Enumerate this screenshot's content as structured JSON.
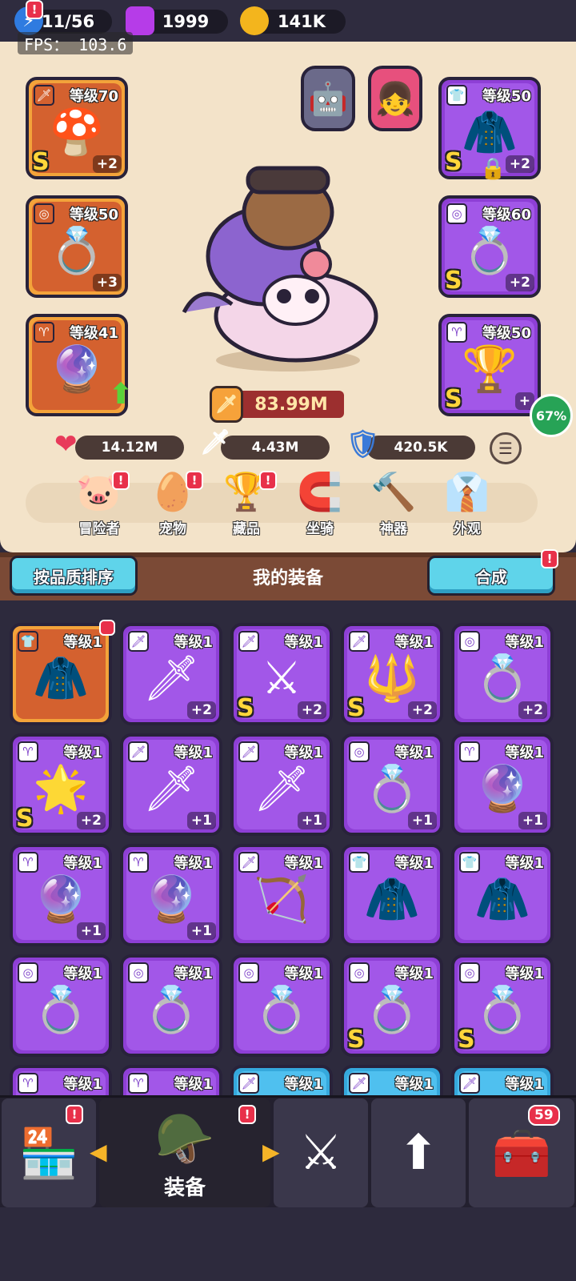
{
  "top": {
    "energy": "11/56",
    "gems": "1999",
    "gold": "141K",
    "fps": "FPS： 103.6",
    "alert": "!"
  },
  "equipped": {
    "left": [
      {
        "level": "等级70",
        "plus": "+2",
        "rank": "S",
        "icon": "🍄",
        "tag": "🗡"
      },
      {
        "level": "等级50",
        "plus": "+3",
        "rank": "",
        "icon": "💍",
        "tag": "◎"
      },
      {
        "level": "等级41",
        "plus": "",
        "rank": "",
        "icon": "🔮",
        "tag": "♈"
      }
    ],
    "right": [
      {
        "level": "等级50",
        "plus": "+2",
        "rank": "S",
        "icon": "🧥",
        "tag": "👕"
      },
      {
        "level": "等级60",
        "plus": "+2",
        "rank": "S",
        "icon": "💍",
        "tag": "◎"
      },
      {
        "level": "等级50",
        "plus": "+",
        "rank": "S",
        "icon": "🏆",
        "tag": "♈"
      }
    ]
  },
  "power": "83.99M",
  "progress_pct": "67%",
  "stats": {
    "hp": "14.12M",
    "atk": "4.43M",
    "def": "420.5K"
  },
  "nav": [
    {
      "label": "冒险者",
      "icon": "🐷",
      "alert": "!"
    },
    {
      "label": "宠物",
      "icon": "🥚",
      "alert": "!"
    },
    {
      "label": "藏品",
      "icon": "🏆",
      "alert": "!"
    },
    {
      "label": "坐骑",
      "icon": "🧲",
      "alert": ""
    },
    {
      "label": "神器",
      "icon": "🔨",
      "alert": ""
    },
    {
      "label": "外观",
      "icon": "👔",
      "alert": ""
    }
  ],
  "inventory_bar": {
    "sort_label": "按品质排序",
    "title": "我的装备",
    "merge_label": "合成",
    "merge_alert": "!"
  },
  "inventory": [
    {
      "q": "orange",
      "level": "等级1",
      "plus": "",
      "rank": "",
      "icon": "🧥",
      "tag": "👕"
    },
    {
      "q": "purple",
      "level": "等级1",
      "plus": "+2",
      "rank": "",
      "icon": "🗡",
      "tag": "🗡"
    },
    {
      "q": "purple",
      "level": "等级1",
      "plus": "+2",
      "rank": "S",
      "icon": "⚔",
      "tag": "🗡"
    },
    {
      "q": "purple",
      "level": "等级1",
      "plus": "+2",
      "rank": "S",
      "icon": "🔱",
      "tag": "🗡"
    },
    {
      "q": "purple",
      "level": "等级1",
      "plus": "+2",
      "rank": "",
      "icon": "💍",
      "tag": "◎"
    },
    {
      "q": "purple",
      "level": "等级1",
      "plus": "+2",
      "rank": "S",
      "icon": "🌟",
      "tag": "♈"
    },
    {
      "q": "purple",
      "level": "等级1",
      "plus": "+1",
      "rank": "",
      "icon": "🗡",
      "tag": "🗡"
    },
    {
      "q": "purple",
      "level": "等级1",
      "plus": "+1",
      "rank": "",
      "icon": "🗡",
      "tag": "🗡"
    },
    {
      "q": "purple",
      "level": "等级1",
      "plus": "+1",
      "rank": "",
      "icon": "💍",
      "tag": "◎"
    },
    {
      "q": "purple",
      "level": "等级1",
      "plus": "+1",
      "rank": "",
      "icon": "🔮",
      "tag": "♈"
    },
    {
      "q": "purple",
      "level": "等级1",
      "plus": "+1",
      "rank": "",
      "icon": "🔮",
      "tag": "♈"
    },
    {
      "q": "purple",
      "level": "等级1",
      "plus": "+1",
      "rank": "",
      "icon": "🔮",
      "tag": "♈"
    },
    {
      "q": "purple",
      "level": "等级1",
      "plus": "",
      "rank": "",
      "icon": "🏹",
      "tag": "🗡"
    },
    {
      "q": "purple",
      "level": "等级1",
      "plus": "",
      "rank": "",
      "icon": "🧥",
      "tag": "👕"
    },
    {
      "q": "purple",
      "level": "等级1",
      "plus": "",
      "rank": "",
      "icon": "🧥",
      "tag": "👕"
    },
    {
      "q": "purple",
      "level": "等级1",
      "plus": "",
      "rank": "",
      "icon": "💍",
      "tag": "◎"
    },
    {
      "q": "purple",
      "level": "等级1",
      "plus": "",
      "rank": "",
      "icon": "💍",
      "tag": "◎"
    },
    {
      "q": "purple",
      "level": "等级1",
      "plus": "",
      "rank": "",
      "icon": "💍",
      "tag": "◎"
    },
    {
      "q": "purple",
      "level": "等级1",
      "plus": "",
      "rank": "S",
      "icon": "💍",
      "tag": "◎"
    },
    {
      "q": "purple",
      "level": "等级1",
      "plus": "",
      "rank": "S",
      "icon": "💍",
      "tag": "◎"
    },
    {
      "q": "purple",
      "level": "等级1",
      "plus": "",
      "rank": "",
      "icon": "",
      "tag": "♈"
    },
    {
      "q": "purple",
      "level": "等级1",
      "plus": "",
      "rank": "",
      "icon": "",
      "tag": "♈"
    },
    {
      "q": "blue",
      "level": "等级1",
      "plus": "",
      "rank": "",
      "icon": "",
      "tag": "🗡"
    },
    {
      "q": "blue",
      "level": "等级1",
      "plus": "",
      "rank": "",
      "icon": "",
      "tag": "🗡"
    },
    {
      "q": "blue",
      "level": "等级1",
      "plus": "",
      "rank": "",
      "icon": "",
      "tag": "🗡"
    }
  ],
  "bottom_tabs": [
    {
      "name": "shop",
      "icon": "🏪",
      "label": "",
      "badge": "!"
    },
    {
      "name": "equipment",
      "icon": "🪖",
      "label": "装备",
      "badge": "!"
    },
    {
      "name": "battle",
      "icon": "⚔",
      "label": "",
      "badge": ""
    },
    {
      "name": "upgrade",
      "icon": "⬆",
      "label": "",
      "badge": ""
    },
    {
      "name": "treasure",
      "icon": "🧰",
      "label": "",
      "badge": "59"
    }
  ]
}
